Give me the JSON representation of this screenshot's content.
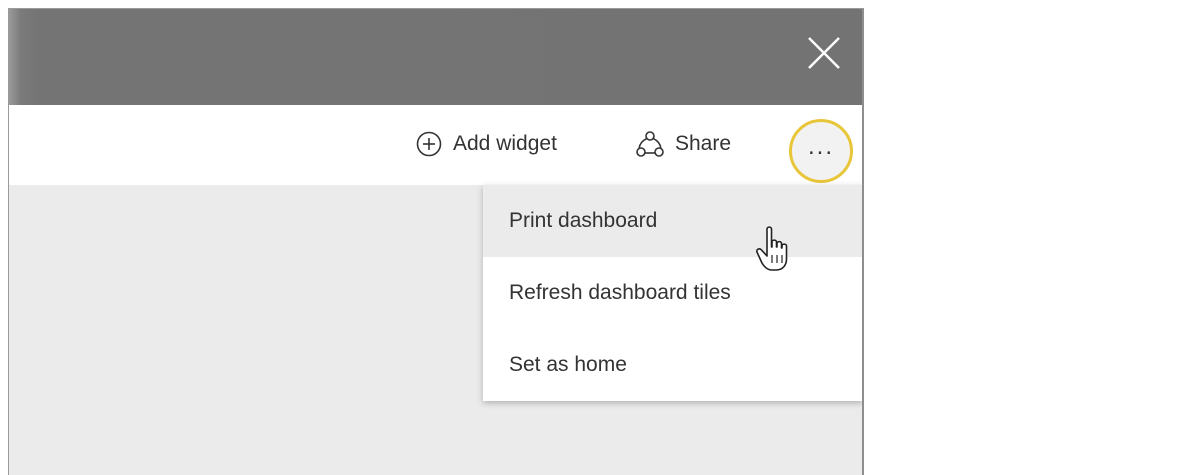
{
  "window": {
    "close_icon": "close-icon"
  },
  "toolbar": {
    "add_widget_label": "Add widget",
    "add_widget_icon": "plus-circle-icon",
    "share_label": "Share",
    "share_icon": "share-icon",
    "more_label": "...",
    "more_icon": "more-options-icon",
    "highlight_color": "#e8c63a"
  },
  "menu": {
    "items": [
      {
        "label": "Print dashboard",
        "state": "hovered"
      },
      {
        "label": "Refresh dashboard tiles"
      },
      {
        "label": "Set as home"
      }
    ]
  },
  "colors": {
    "title_bar": "#737373",
    "content_background": "#ebebeb",
    "menu_background": "#ffffff",
    "text": "#333333"
  }
}
